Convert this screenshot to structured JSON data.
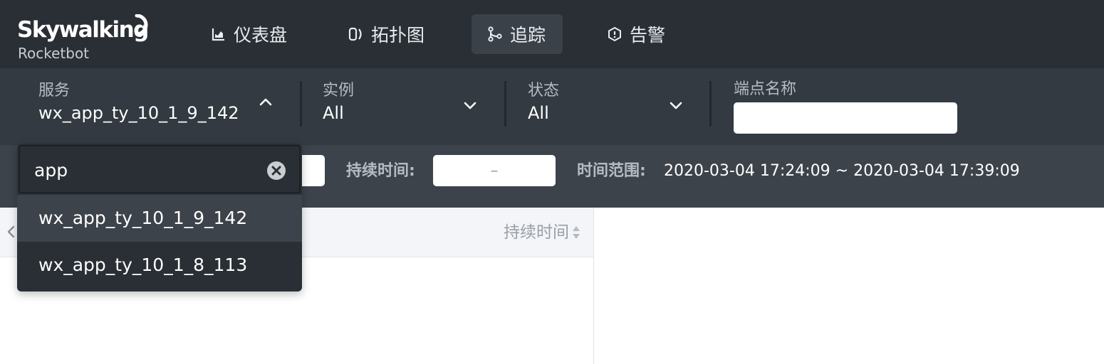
{
  "logo": {
    "main": "Skywalking",
    "sub": "Rocketbot"
  },
  "nav": {
    "items": [
      {
        "label": "仪表盘",
        "icon": "chart-icon"
      },
      {
        "label": "拓扑图",
        "icon": "topology-icon"
      },
      {
        "label": "追踪",
        "icon": "trace-icon",
        "active": true
      },
      {
        "label": "告警",
        "icon": "alarm-icon"
      }
    ]
  },
  "filters": {
    "service": {
      "label": "服务",
      "value": "wx_app_ty_10_1_9_142"
    },
    "instance": {
      "label": "实例",
      "value": "All"
    },
    "status": {
      "label": "状态",
      "value": "All"
    },
    "endpoint": {
      "label": "端点名称",
      "value": ""
    }
  },
  "secondbar": {
    "duration_label": "持续时间:",
    "duration_value": "–",
    "range_label": "时间范围:",
    "range_value": "2020-03-04 17:24:09 ~ 2020-03-04 17:39:09"
  },
  "table": {
    "duration_header": "持续时间"
  },
  "dropdown": {
    "search_value": "app",
    "options": [
      "wx_app_ty_10_1_9_142",
      "wx_app_ty_10_1_8_113"
    ]
  },
  "colors": {
    "nav_bg": "#2a2f35",
    "filter_bg": "#333a41",
    "accent_active": "#3b4148"
  }
}
